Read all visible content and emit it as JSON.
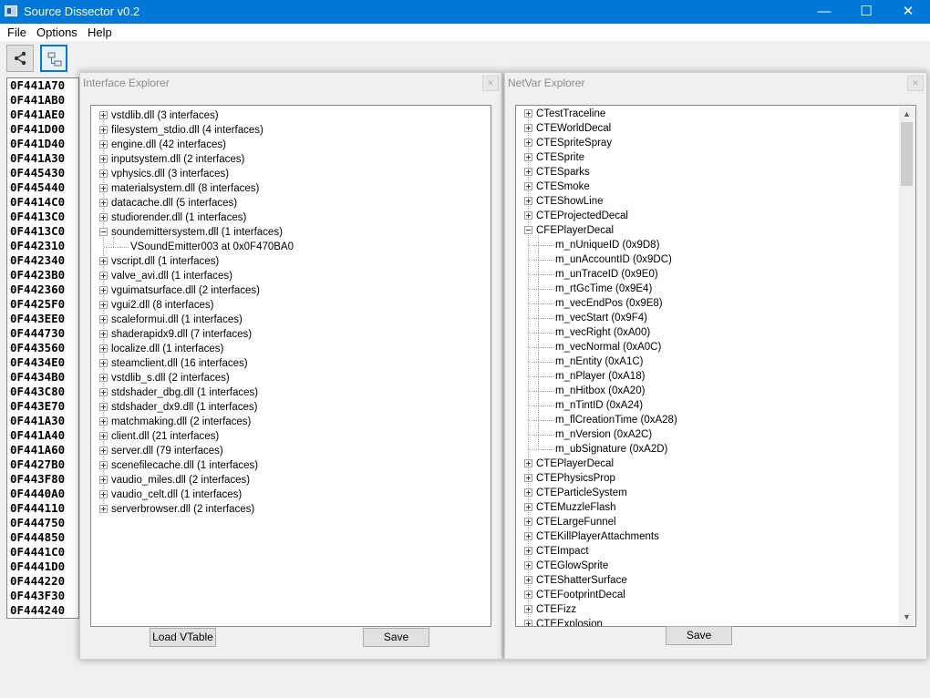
{
  "window": {
    "title": "Source Dissector v0.2",
    "minimize": "—",
    "maximize": "☐",
    "close": "✕"
  },
  "menu": [
    "File",
    "Options",
    "Help"
  ],
  "toolbar": {
    "buttons": [
      {
        "icon": "share-icon"
      },
      {
        "icon": "hierarchy-icon",
        "active": true
      }
    ]
  },
  "addresses": [
    "0F441A70",
    "0F441AB0",
    "0F441AE0",
    "0F441D00",
    "0F441D40",
    "0F441A30",
    "0F445430",
    "0F445440",
    "0F4414C0",
    "0F4413C0",
    "0F4413C0",
    "0F442310",
    "0F442340",
    "0F4423B0",
    "0F442360",
    "0F4425F0",
    "0F443EE0",
    "0F444730",
    "0F443560",
    "0F4434E0",
    "0F4434B0",
    "0F443C80",
    "0F443E70",
    "0F441A30",
    "0F441A40",
    "0F441A60",
    "0F4427B0",
    "0F443F80",
    "0F4440A0",
    "0F444110",
    "0F444750",
    "0F444850",
    "0F4441C0",
    "0F4441D0",
    "0F444220",
    "0F443F30",
    "0F444240"
  ],
  "interface_explorer": {
    "title": "Interface Explorer",
    "close": "✕",
    "items": [
      {
        "label": "vstdlib.dll (3 interfaces)"
      },
      {
        "label": "filesystem_stdio.dll (4 interfaces)"
      },
      {
        "label": "engine.dll (42 interfaces)"
      },
      {
        "label": "inputsystem.dll (2 interfaces)"
      },
      {
        "label": "vphysics.dll (3 interfaces)"
      },
      {
        "label": "materialsystem.dll (8 interfaces)"
      },
      {
        "label": "datacache.dll (5 interfaces)"
      },
      {
        "label": "studiorender.dll (1 interfaces)"
      },
      {
        "label": "soundemittersystem.dll (1 interfaces)",
        "expanded": true,
        "children": [
          "VSoundEmitter003 at 0x0F470BA0"
        ]
      },
      {
        "label": "vscript.dll (1 interfaces)"
      },
      {
        "label": "valve_avi.dll (1 interfaces)"
      },
      {
        "label": "vguimatsurface.dll (2 interfaces)"
      },
      {
        "label": "vgui2.dll (8 interfaces)"
      },
      {
        "label": "scaleformui.dll (1 interfaces)"
      },
      {
        "label": "shaderapidx9.dll (7 interfaces)"
      },
      {
        "label": "localize.dll (1 interfaces)"
      },
      {
        "label": "steamclient.dll (16 interfaces)"
      },
      {
        "label": "vstdlib_s.dll (2 interfaces)"
      },
      {
        "label": "stdshader_dbg.dll (1 interfaces)"
      },
      {
        "label": "stdshader_dx9.dll (1 interfaces)"
      },
      {
        "label": "matchmaking.dll (2 interfaces)"
      },
      {
        "label": "client.dll (21 interfaces)"
      },
      {
        "label": "server.dll (79 interfaces)"
      },
      {
        "label": "scenefilecache.dll (1 interfaces)"
      },
      {
        "label": "vaudio_miles.dll (2 interfaces)"
      },
      {
        "label": "vaudio_celt.dll (1 interfaces)"
      },
      {
        "label": "serverbrowser.dll (2 interfaces)"
      }
    ],
    "load_button": "Load VTable",
    "save_button": "Save"
  },
  "netvar_explorer": {
    "title": "NetVar Explorer",
    "close": "✕",
    "items": [
      {
        "label": "CTestTraceline"
      },
      {
        "label": "CTEWorldDecal"
      },
      {
        "label": "CTESpriteSpray"
      },
      {
        "label": "CTESprite"
      },
      {
        "label": "CTESparks"
      },
      {
        "label": "CTESmoke"
      },
      {
        "label": "CTEShowLine"
      },
      {
        "label": "CTEProjectedDecal"
      },
      {
        "label": "CFEPlayerDecal",
        "expanded": true,
        "children": [
          "m_nUniqueID (0x9D8)",
          "m_unAccountID (0x9DC)",
          "m_unTraceID (0x9E0)",
          "m_rtGcTime (0x9E4)",
          "m_vecEndPos (0x9E8)",
          "m_vecStart (0x9F4)",
          "m_vecRight (0xA00)",
          "m_vecNormal (0xA0C)",
          "m_nEntity (0xA1C)",
          "m_nPlayer (0xA18)",
          "m_nHitbox (0xA20)",
          "m_nTintID (0xA24)",
          "m_flCreationTime (0xA28)",
          "m_nVersion (0xA2C)",
          "m_ubSignature (0xA2D)"
        ]
      },
      {
        "label": "CTEPlayerDecal"
      },
      {
        "label": "CTEPhysicsProp"
      },
      {
        "label": "CTEParticleSystem"
      },
      {
        "label": "CTEMuzzleFlash"
      },
      {
        "label": "CTELargeFunnel"
      },
      {
        "label": "CTEKillPlayerAttachments"
      },
      {
        "label": "CTEImpact"
      },
      {
        "label": "CTEGlowSprite"
      },
      {
        "label": "CTEShatterSurface"
      },
      {
        "label": "CTEFootprintDecal"
      },
      {
        "label": "CTEFizz"
      },
      {
        "label": "CTEExplosion"
      }
    ],
    "scroll_position": 0.0,
    "save_button": "Save"
  }
}
